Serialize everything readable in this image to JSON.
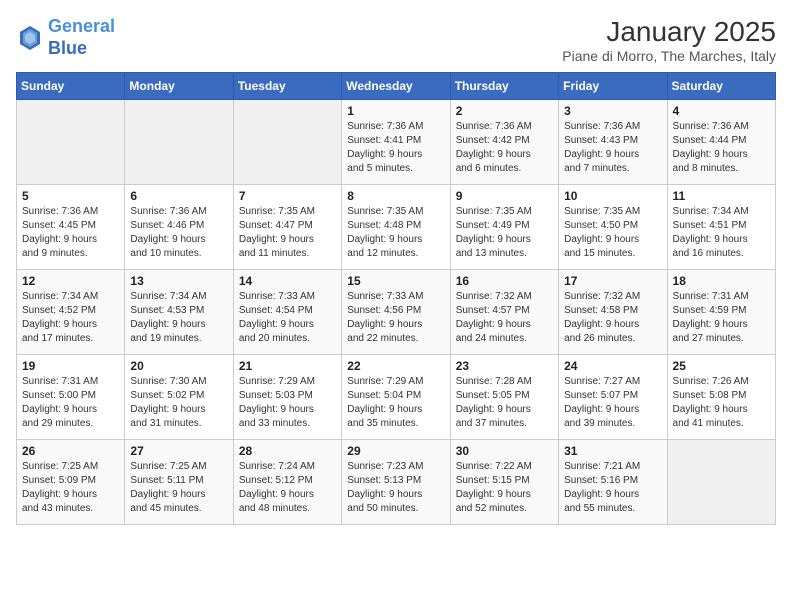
{
  "header": {
    "logo_line1": "General",
    "logo_line2": "Blue",
    "month": "January 2025",
    "location": "Piane di Morro, The Marches, Italy"
  },
  "days_of_week": [
    "Sunday",
    "Monday",
    "Tuesday",
    "Wednesday",
    "Thursday",
    "Friday",
    "Saturday"
  ],
  "weeks": [
    [
      {
        "num": "",
        "info": ""
      },
      {
        "num": "",
        "info": ""
      },
      {
        "num": "",
        "info": ""
      },
      {
        "num": "1",
        "info": "Sunrise: 7:36 AM\nSunset: 4:41 PM\nDaylight: 9 hours\nand 5 minutes."
      },
      {
        "num": "2",
        "info": "Sunrise: 7:36 AM\nSunset: 4:42 PM\nDaylight: 9 hours\nand 6 minutes."
      },
      {
        "num": "3",
        "info": "Sunrise: 7:36 AM\nSunset: 4:43 PM\nDaylight: 9 hours\nand 7 minutes."
      },
      {
        "num": "4",
        "info": "Sunrise: 7:36 AM\nSunset: 4:44 PM\nDaylight: 9 hours\nand 8 minutes."
      }
    ],
    [
      {
        "num": "5",
        "info": "Sunrise: 7:36 AM\nSunset: 4:45 PM\nDaylight: 9 hours\nand 9 minutes."
      },
      {
        "num": "6",
        "info": "Sunrise: 7:36 AM\nSunset: 4:46 PM\nDaylight: 9 hours\nand 10 minutes."
      },
      {
        "num": "7",
        "info": "Sunrise: 7:35 AM\nSunset: 4:47 PM\nDaylight: 9 hours\nand 11 minutes."
      },
      {
        "num": "8",
        "info": "Sunrise: 7:35 AM\nSunset: 4:48 PM\nDaylight: 9 hours\nand 12 minutes."
      },
      {
        "num": "9",
        "info": "Sunrise: 7:35 AM\nSunset: 4:49 PM\nDaylight: 9 hours\nand 13 minutes."
      },
      {
        "num": "10",
        "info": "Sunrise: 7:35 AM\nSunset: 4:50 PM\nDaylight: 9 hours\nand 15 minutes."
      },
      {
        "num": "11",
        "info": "Sunrise: 7:34 AM\nSunset: 4:51 PM\nDaylight: 9 hours\nand 16 minutes."
      }
    ],
    [
      {
        "num": "12",
        "info": "Sunrise: 7:34 AM\nSunset: 4:52 PM\nDaylight: 9 hours\nand 17 minutes."
      },
      {
        "num": "13",
        "info": "Sunrise: 7:34 AM\nSunset: 4:53 PM\nDaylight: 9 hours\nand 19 minutes."
      },
      {
        "num": "14",
        "info": "Sunrise: 7:33 AM\nSunset: 4:54 PM\nDaylight: 9 hours\nand 20 minutes."
      },
      {
        "num": "15",
        "info": "Sunrise: 7:33 AM\nSunset: 4:56 PM\nDaylight: 9 hours\nand 22 minutes."
      },
      {
        "num": "16",
        "info": "Sunrise: 7:32 AM\nSunset: 4:57 PM\nDaylight: 9 hours\nand 24 minutes."
      },
      {
        "num": "17",
        "info": "Sunrise: 7:32 AM\nSunset: 4:58 PM\nDaylight: 9 hours\nand 26 minutes."
      },
      {
        "num": "18",
        "info": "Sunrise: 7:31 AM\nSunset: 4:59 PM\nDaylight: 9 hours\nand 27 minutes."
      }
    ],
    [
      {
        "num": "19",
        "info": "Sunrise: 7:31 AM\nSunset: 5:00 PM\nDaylight: 9 hours\nand 29 minutes."
      },
      {
        "num": "20",
        "info": "Sunrise: 7:30 AM\nSunset: 5:02 PM\nDaylight: 9 hours\nand 31 minutes."
      },
      {
        "num": "21",
        "info": "Sunrise: 7:29 AM\nSunset: 5:03 PM\nDaylight: 9 hours\nand 33 minutes."
      },
      {
        "num": "22",
        "info": "Sunrise: 7:29 AM\nSunset: 5:04 PM\nDaylight: 9 hours\nand 35 minutes."
      },
      {
        "num": "23",
        "info": "Sunrise: 7:28 AM\nSunset: 5:05 PM\nDaylight: 9 hours\nand 37 minutes."
      },
      {
        "num": "24",
        "info": "Sunrise: 7:27 AM\nSunset: 5:07 PM\nDaylight: 9 hours\nand 39 minutes."
      },
      {
        "num": "25",
        "info": "Sunrise: 7:26 AM\nSunset: 5:08 PM\nDaylight: 9 hours\nand 41 minutes."
      }
    ],
    [
      {
        "num": "26",
        "info": "Sunrise: 7:25 AM\nSunset: 5:09 PM\nDaylight: 9 hours\nand 43 minutes."
      },
      {
        "num": "27",
        "info": "Sunrise: 7:25 AM\nSunset: 5:11 PM\nDaylight: 9 hours\nand 45 minutes."
      },
      {
        "num": "28",
        "info": "Sunrise: 7:24 AM\nSunset: 5:12 PM\nDaylight: 9 hours\nand 48 minutes."
      },
      {
        "num": "29",
        "info": "Sunrise: 7:23 AM\nSunset: 5:13 PM\nDaylight: 9 hours\nand 50 minutes."
      },
      {
        "num": "30",
        "info": "Sunrise: 7:22 AM\nSunset: 5:15 PM\nDaylight: 9 hours\nand 52 minutes."
      },
      {
        "num": "31",
        "info": "Sunrise: 7:21 AM\nSunset: 5:16 PM\nDaylight: 9 hours\nand 55 minutes."
      },
      {
        "num": "",
        "info": ""
      }
    ]
  ]
}
